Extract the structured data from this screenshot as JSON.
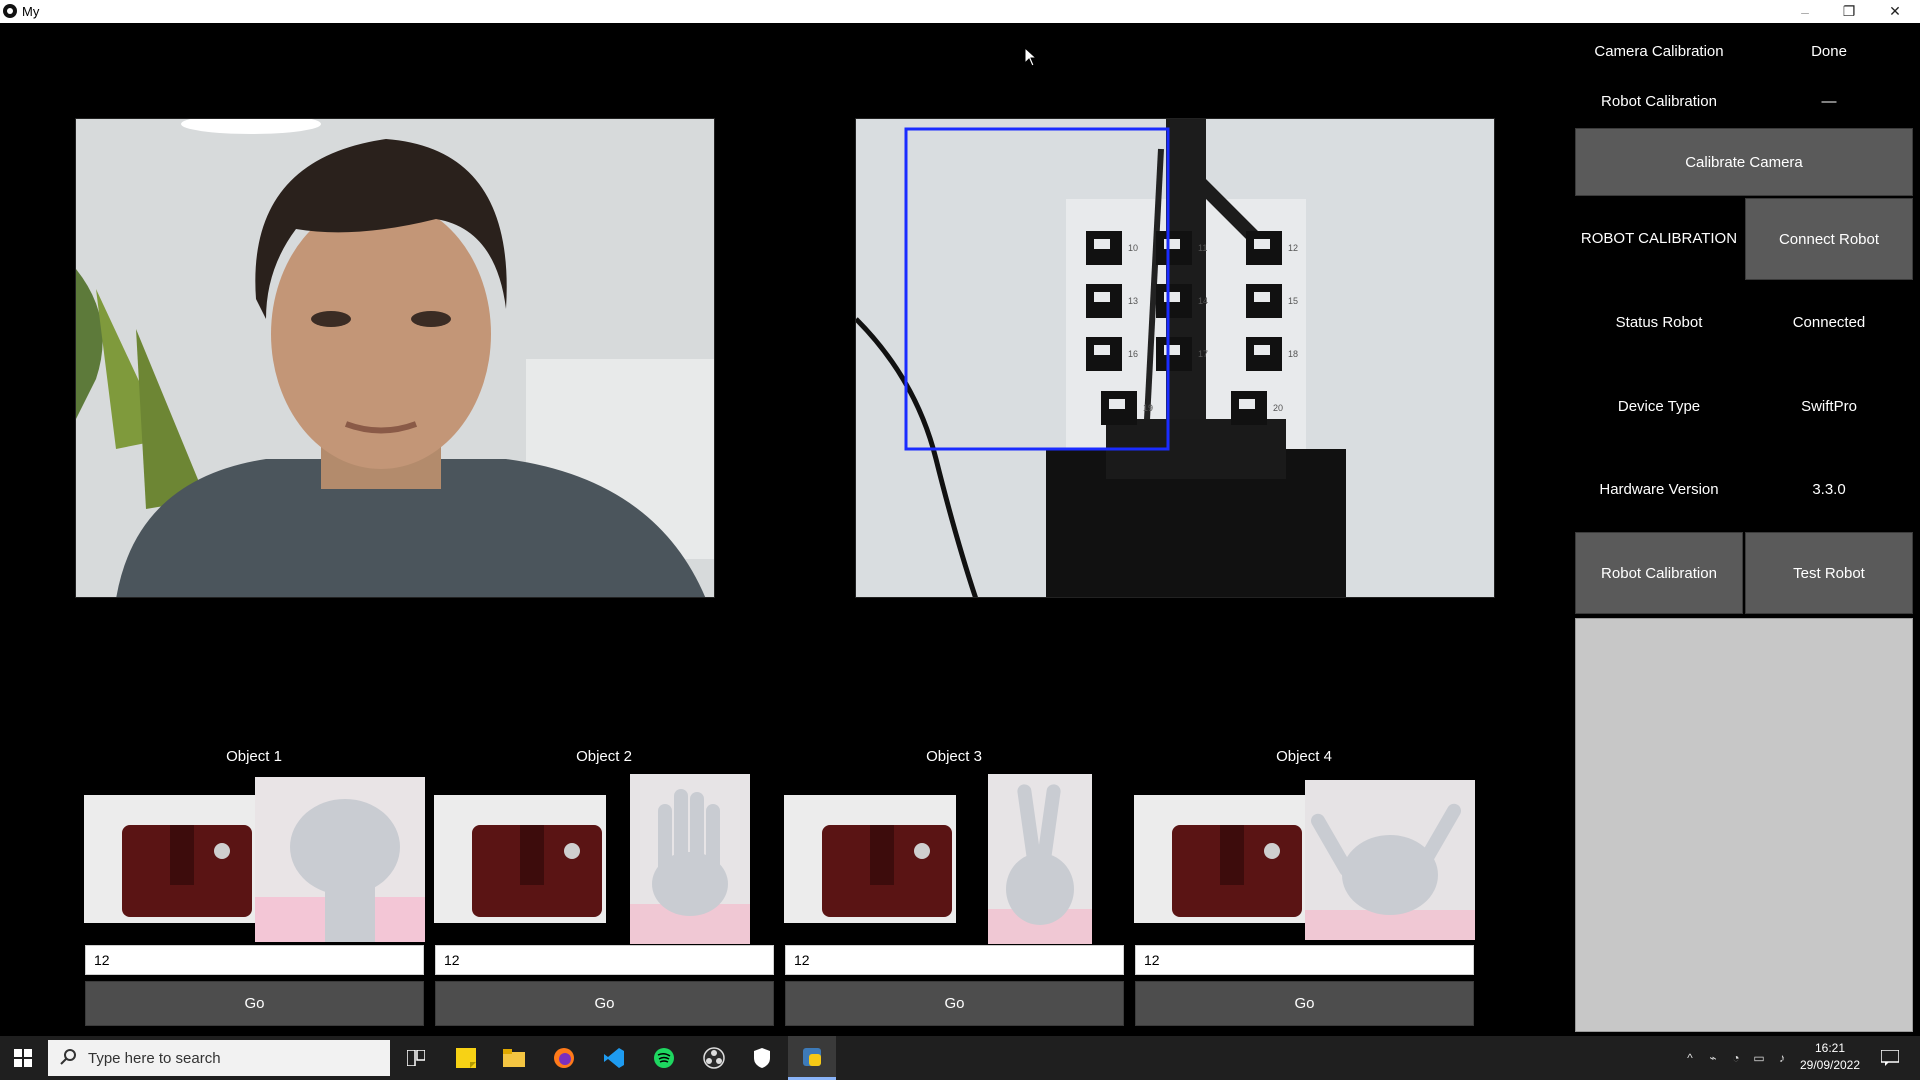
{
  "window": {
    "title": "My"
  },
  "right_panel": {
    "camera_calibration_label": "Camera Calibration",
    "camera_calibration_value": "Done",
    "robot_calibration_label": "Robot Calibration",
    "robot_calibration_value": "—",
    "calibrate_camera_button": "Calibrate Camera",
    "robot_calibration_heading": "ROBOT CALIBRATION",
    "connect_robot_button": "Connect Robot",
    "status_robot_label": "Status Robot",
    "status_robot_value": "Connected",
    "device_type_label": "Device Type",
    "device_type_value": "SwiftPro",
    "hardware_version_label": "Hardware Version",
    "hardware_version_value": "3.3.0",
    "robot_calibration_button": "Robot Calibration",
    "test_robot_button": "Test Robot"
  },
  "robot_feed": {
    "marker_labels": [
      "10",
      "11",
      "12",
      "13",
      "14",
      "15",
      "16",
      "17",
      "18",
      "19",
      "20"
    ]
  },
  "objects": [
    {
      "title": "Object 1",
      "value": "12",
      "go_label": "Go",
      "gesture": "fist"
    },
    {
      "title": "Object 2",
      "value": "12",
      "go_label": "Go",
      "gesture": "open-palm"
    },
    {
      "title": "Object 3",
      "value": "12",
      "go_label": "Go",
      "gesture": "two-fingers"
    },
    {
      "title": "Object 4",
      "value": "12",
      "go_label": "Go",
      "gesture": "hang-loose"
    }
  ],
  "taskbar": {
    "search_placeholder": "Type here to search",
    "time": "16:21",
    "date": "29/09/2022"
  },
  "colors": {
    "app_background": "#000000",
    "button_gray": "#5a5a5a",
    "detection_box": "#1a2cff",
    "log_area": "#c7c7c7"
  }
}
